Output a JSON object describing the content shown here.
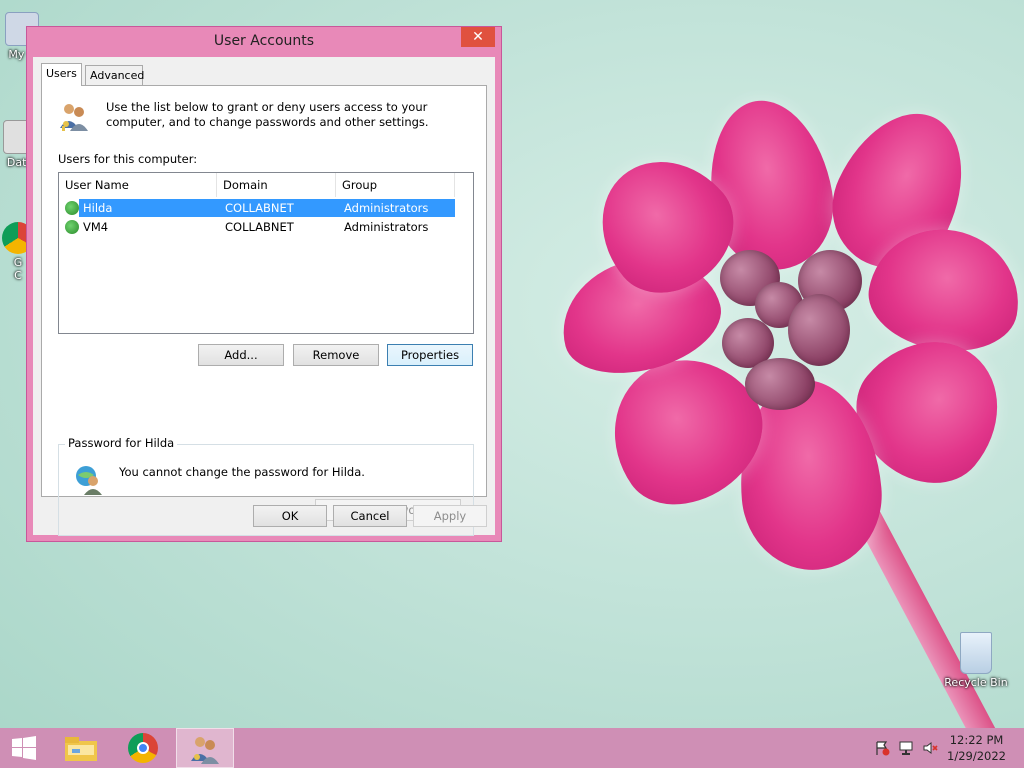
{
  "desktop": {
    "icons": [
      {
        "label": "My C"
      },
      {
        "label": "Data"
      },
      {
        "label": "G\nC"
      },
      {
        "label": "Recycle Bin"
      }
    ]
  },
  "dialog": {
    "title": "User Accounts",
    "close_glyph": "✕",
    "tabs": [
      {
        "label": "Users",
        "active": true
      },
      {
        "label": "Advanced",
        "active": false
      }
    ],
    "intro_text": "Use the list below to grant or deny users access to your computer, and to change passwords and other settings.",
    "users_label": "Users for this computer:",
    "list": {
      "columns": [
        "User Name",
        "Domain",
        "Group"
      ],
      "rows": [
        {
          "user": "Hilda",
          "domain": "COLLABNET",
          "group": "Administrators",
          "selected": true
        },
        {
          "user": "VM4",
          "domain": "COLLABNET",
          "group": "Administrators",
          "selected": false
        }
      ]
    },
    "buttons": {
      "add": "Add...",
      "remove": "Remove",
      "properties": "Properties",
      "ok": "OK",
      "cancel": "Cancel",
      "apply": "Apply",
      "reset_password": "Reset Password..."
    },
    "password_group": {
      "title": "Password for Hilda",
      "message": "You cannot change the password for Hilda."
    }
  },
  "taskbar": {
    "items": [
      {
        "icon": "windows-start-icon"
      },
      {
        "icon": "file-explorer-icon"
      },
      {
        "icon": "chrome-icon"
      },
      {
        "icon": "user-accounts-icon",
        "active": true
      }
    ],
    "clock": {
      "time": "12:22 PM",
      "date": "1/29/2022"
    }
  },
  "colors": {
    "window_frame": "#e889b8",
    "close_button": "#e0513f",
    "selection": "#3399ff",
    "taskbar": "#cf8fb5"
  }
}
